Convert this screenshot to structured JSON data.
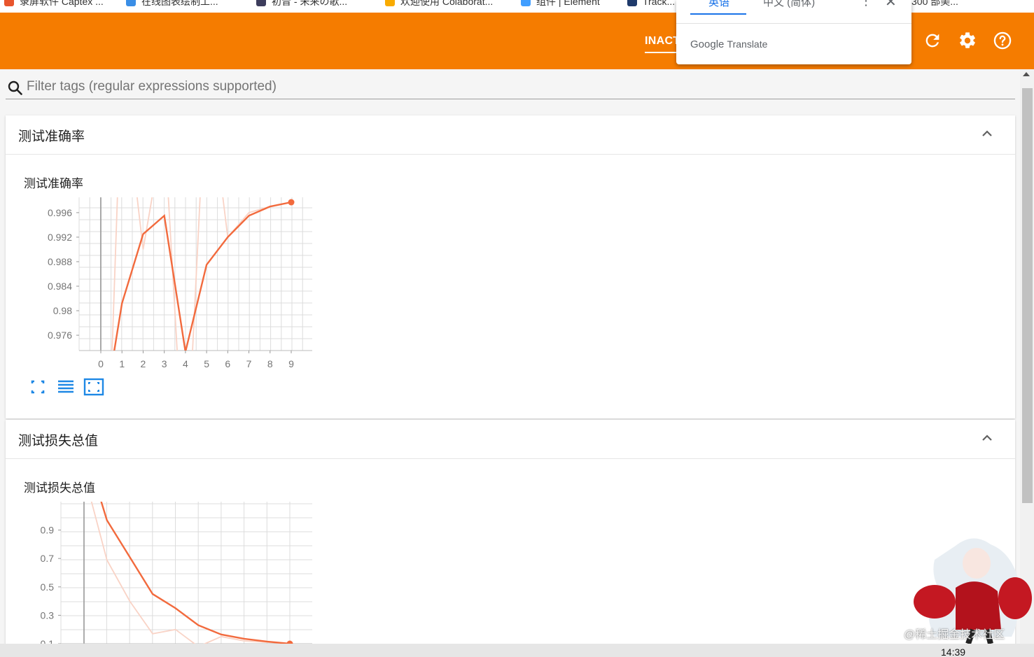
{
  "bookmarks": [
    {
      "label": "录屏软件 Captex ..."
    },
    {
      "label": "在线图表绘制工..."
    },
    {
      "label": "初音 - 未来の歌..."
    },
    {
      "label": "欢迎使用 Colaborat..."
    },
    {
      "label": "组件 | Element"
    },
    {
      "label": "Track..."
    },
    {
      "label": "300 部美..."
    }
  ],
  "toolbar": {
    "inactive_label": "INACTIVE",
    "icons": [
      "refresh-icon",
      "settings-icon",
      "help-icon"
    ]
  },
  "translate": {
    "tab_source": "英语",
    "tab_target": "中文 (简体)",
    "brand_google": "Google",
    "brand_translate": "Translate"
  },
  "filter": {
    "placeholder": "Filter tags (regular expressions supported)"
  },
  "panels": [
    {
      "title": "测试准确率",
      "card_title": "测试准确率",
      "chart_data": {
        "type": "line",
        "title": "测试准确率",
        "x": [
          0,
          1,
          2,
          3,
          4,
          5,
          6,
          7,
          8,
          9
        ],
        "xticks": [
          "0",
          "1",
          "2",
          "3",
          "4",
          "5",
          "6",
          "7",
          "8",
          "9"
        ],
        "yticks": [
          "0.976",
          "0.98",
          "0.984",
          "0.988",
          "0.992",
          "0.996"
        ],
        "ylim": [
          0.9735,
          0.9985
        ],
        "series": [
          {
            "values": [
              0.96,
              0.9812,
              0.9925,
              0.9955,
              0.9733,
              0.9875,
              0.992,
              0.9955,
              0.997,
              0.9977
            ],
            "color": "#f26a3d"
          },
          {
            "values": [
              0.92,
              1.02,
              0.99,
              1.01,
              0.95,
              1.02,
              0.992,
              0.996,
              0.997,
              0.9977
            ],
            "color": "#f9d3c6"
          }
        ],
        "grid": true
      }
    },
    {
      "title": "测试损失总值",
      "card_title": "测试损失总值",
      "chart_data": {
        "type": "line",
        "title": "测试损失总值",
        "x": [
          0,
          1,
          2,
          3,
          4,
          5,
          6,
          7,
          8,
          9
        ],
        "yticks": [
          "0.1",
          "0.3",
          "0.5",
          "0.7",
          "0.9"
        ],
        "ylim": [
          0.1,
          1.1
        ],
        "series": [
          {
            "values": [
              1.5,
              0.97,
              0.71,
              0.45,
              0.35,
              0.23,
              0.165,
              0.135,
              0.115,
              0.1
            ],
            "color": "#f26a3d"
          },
          {
            "values": [
              1.3,
              0.69,
              0.4,
              0.17,
              0.2,
              0.08,
              0.15,
              0.12,
              0.11,
              0.1
            ],
            "color": "#f9d3c6"
          }
        ],
        "grid": true
      }
    }
  ],
  "chart_buttons": [
    "fullscreen-icon",
    "list-icon",
    "fit-domain-icon"
  ],
  "taskbar": {
    "time": "14:39"
  },
  "watermark": "@稀土掘金技术社区",
  "colors": {
    "toolbar": "#f57c00",
    "accent": "#1a73e8",
    "line": "#f26a3d",
    "button": "#2196f3"
  }
}
